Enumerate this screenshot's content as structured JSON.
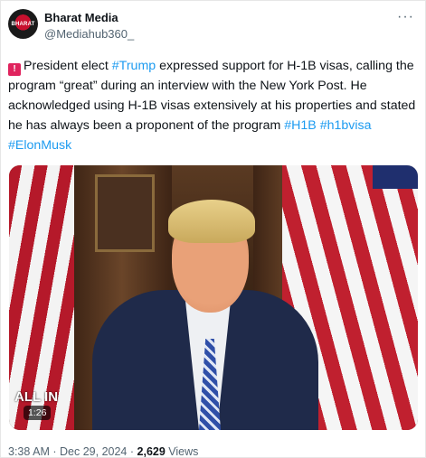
{
  "header": {
    "display_name": "Bharat Media",
    "handle": "@Mediahub360_",
    "more_icon": "more-dots-icon",
    "avatar_text": "BHARAT"
  },
  "tweet": {
    "emoji": "rotating-light",
    "text_1": "President elect ",
    "tag_trump": "#Trump",
    "text_2": " expressed support for H-1B visas, calling the program “great” during an interview with the New York Post. He acknowledged using H-1B visas extensively at his properties and stated he has always been a proponent of the program ",
    "tag_h1b": "#H1B",
    "tag_h1bvisa": "#h1bvisa",
    "tag_elonmusk": "#ElonMusk"
  },
  "video": {
    "badge": "ALL IN",
    "duration": "1:26"
  },
  "meta": {
    "time": "3:38 AM",
    "separator": "·",
    "date": "Dec 29, 2024",
    "views_count": "2,629",
    "views_label": "Views"
  },
  "colors": {
    "link": "#1d9bf0",
    "muted": "#536471",
    "text": "#0f1419"
  }
}
